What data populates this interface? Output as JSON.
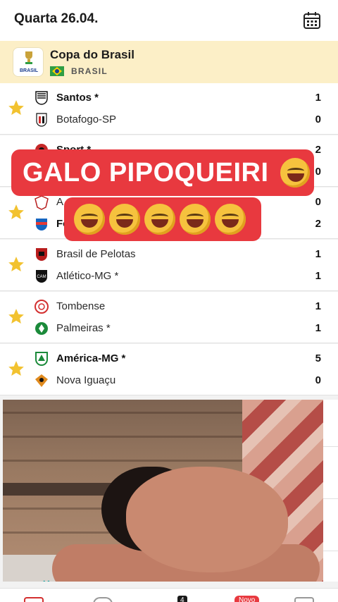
{
  "header": {
    "date": "Quarta 26.04."
  },
  "league": {
    "name": "Copa do Brasil",
    "country": "BRASIL",
    "logo_text": "BRASIL"
  },
  "matches": [
    {
      "favorite": true,
      "home": "Santos *",
      "away": "Botafogo-SP",
      "home_score": "1",
      "away_score": "0",
      "home_bold": true
    },
    {
      "favorite": false,
      "home": "Sport *",
      "away": "",
      "home_score": "2",
      "away_score": "0",
      "home_bold": true
    },
    {
      "favorite": true,
      "home": "A",
      "away": "Fo",
      "home_score": "0",
      "away_score": "2",
      "home_bold": false
    },
    {
      "favorite": true,
      "home": "Brasil de Pelotas",
      "away": "Atlético-MG *",
      "home_score": "1",
      "away_score": "1",
      "home_bold": false
    },
    {
      "favorite": true,
      "home": "Tombense",
      "away": "Palmeiras *",
      "home_score": "1",
      "away_score": "1",
      "home_bold": false
    },
    {
      "favorite": true,
      "home": "América-MG *",
      "away": "Nova Iguaçu",
      "home_score": "5",
      "away_score": "0",
      "home_bold": true
    }
  ],
  "overlay": {
    "caption": "GALO PIPOQUEIRI",
    "emoji_count": 5
  },
  "ad": {
    "close_label": "✕"
  },
  "bottom_nav": {
    "badge_new": "Novo",
    "badge_count": "4"
  },
  "colors": {
    "accent": "#e8393f",
    "star": "#f2c230",
    "league_bg": "#fcefc7"
  }
}
